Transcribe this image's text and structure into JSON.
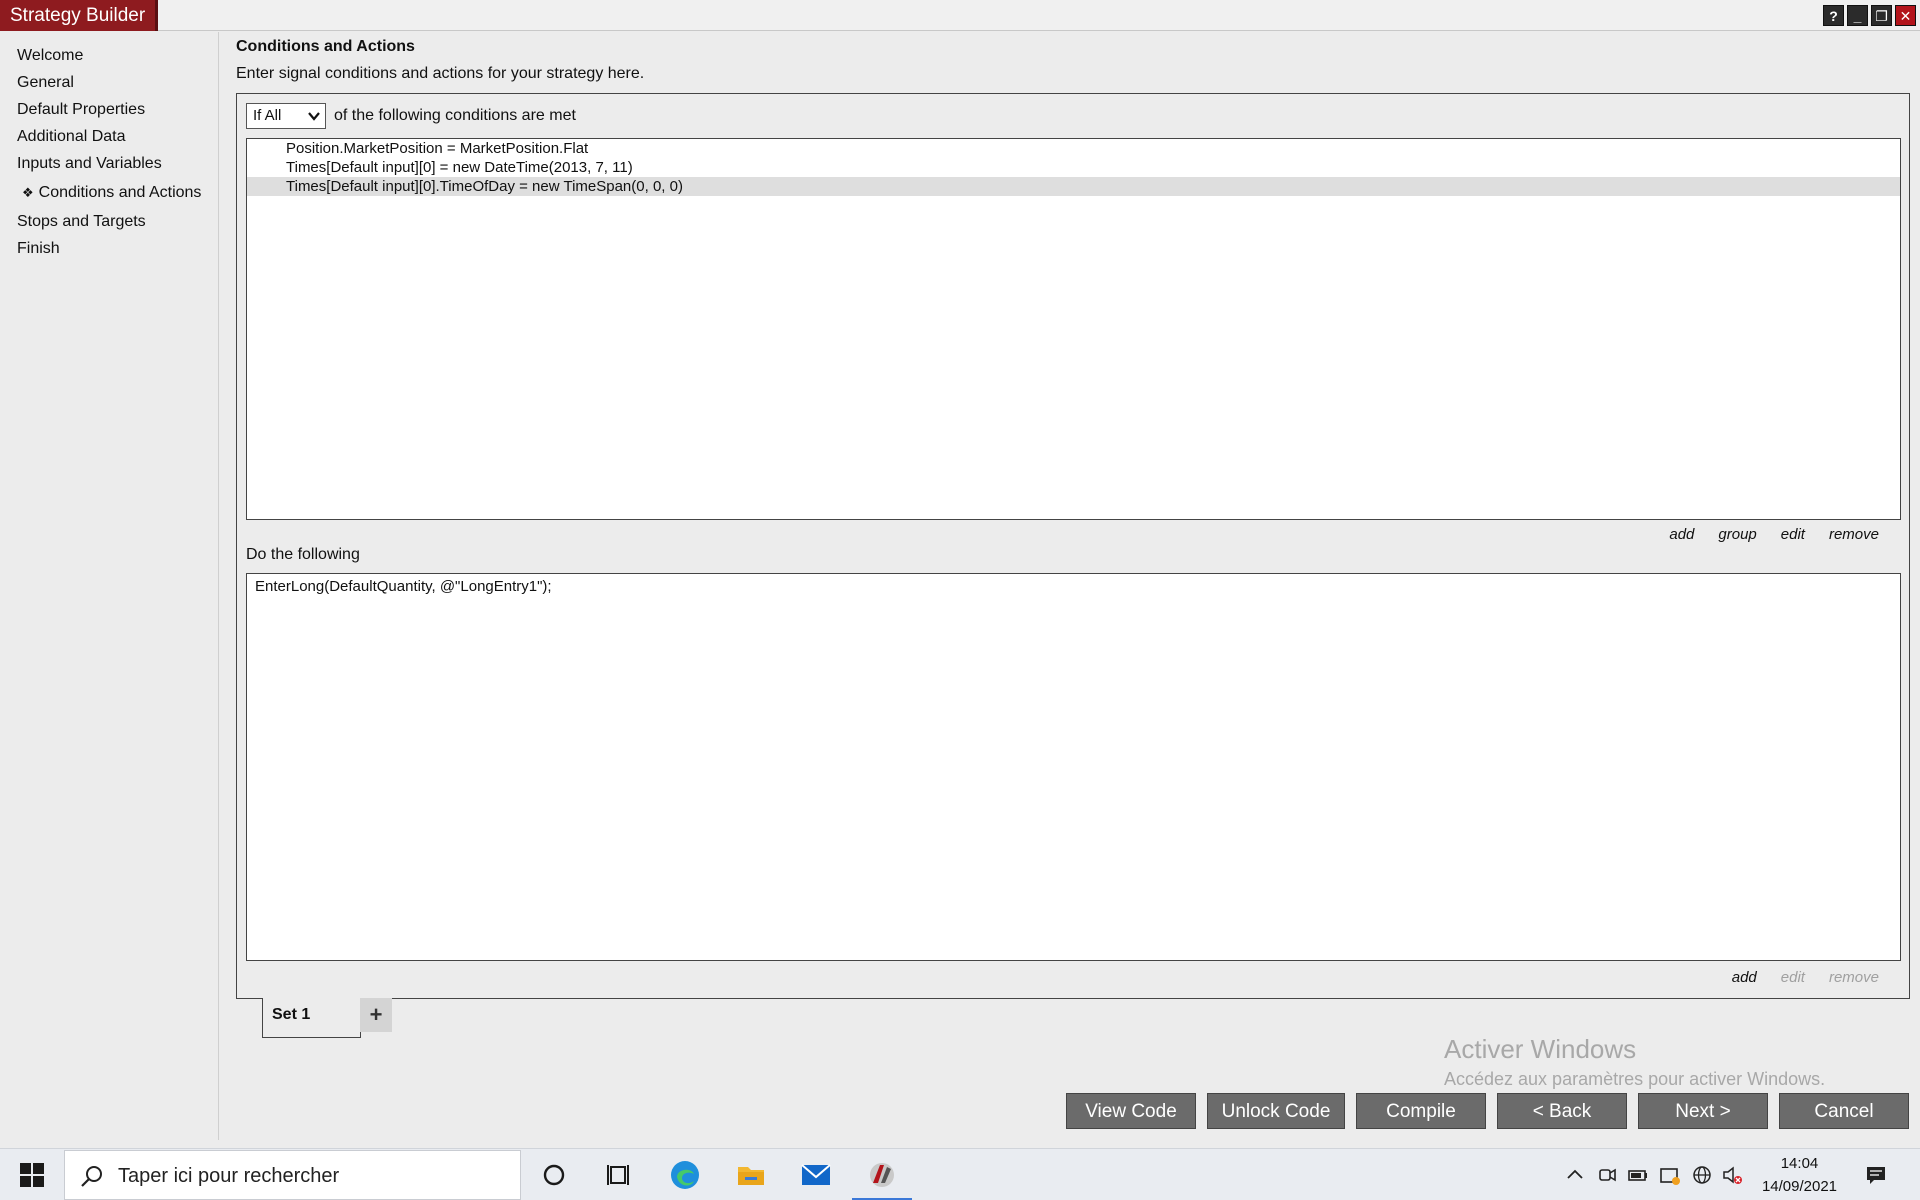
{
  "window": {
    "title": "Strategy Builder",
    "help_label": "?",
    "minimize_label": "_",
    "restore_label": "❐",
    "close_label": "✕"
  },
  "nav": {
    "items": [
      {
        "label": "Welcome"
      },
      {
        "label": "General"
      },
      {
        "label": "Default Properties"
      },
      {
        "label": "Additional Data"
      },
      {
        "label": "Inputs and Variables"
      },
      {
        "label": "Conditions and Actions",
        "active": true
      },
      {
        "label": "Stops and Targets"
      },
      {
        "label": "Finish"
      }
    ],
    "active_bullet": "❖"
  },
  "main": {
    "title": "Conditions and Actions",
    "subtitle": "Enter signal conditions and actions for your strategy here.",
    "condition_mode": {
      "selected": "If All",
      "suffix": "of the following conditions are met"
    },
    "conditions": [
      "Position.MarketPosition = MarketPosition.Flat",
      "Times[Default input][0] = new DateTime(2013, 7, 11)",
      "Times[Default input][0].TimeOfDay = new TimeSpan(0, 0, 0)"
    ],
    "selected_condition_index": 2,
    "condition_actions": {
      "add": "add",
      "group": "group",
      "edit": "edit",
      "remove": "remove"
    },
    "do_label": "Do the following",
    "actions": [
      "EnterLong(DefaultQuantity, @\"LongEntry1\");"
    ],
    "action_actions": {
      "add": "add",
      "edit": "edit",
      "remove": "remove"
    },
    "sets": [
      {
        "label": "Set 1"
      }
    ],
    "add_set_label": "+"
  },
  "watermark": {
    "title": "Activer Windows",
    "text": "Accédez aux paramètres pour activer Windows."
  },
  "buttons": {
    "view_code": "View Code",
    "unlock_code": "Unlock Code",
    "compile": "Compile",
    "back": "< Back",
    "next": "Next >",
    "cancel": "Cancel"
  },
  "taskbar": {
    "search_placeholder": "Taper ici pour rechercher",
    "time": "14:04",
    "date": "14/09/2021"
  },
  "colors": {
    "title_accent": "#8e1b1f",
    "button_bg": "#6b6b6b",
    "close_button": "#b3141b"
  }
}
